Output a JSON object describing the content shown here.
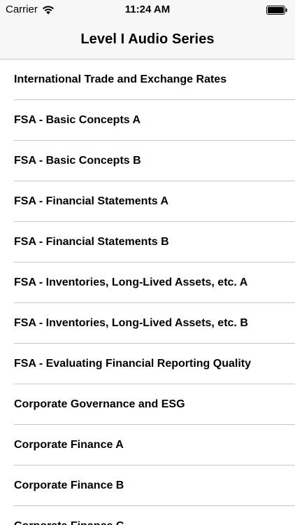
{
  "status_bar": {
    "carrier": "Carrier",
    "time": "11:24 AM",
    "wifi_icon": "wifi-icon",
    "battery_icon": "battery-icon"
  },
  "nav": {
    "title": "Level I Audio Series"
  },
  "items": [
    {
      "label": "International Trade and Exchange Rates"
    },
    {
      "label": "FSA - Basic Concepts A"
    },
    {
      "label": "FSA - Basic Concepts B"
    },
    {
      "label": "FSA - Financial Statements A"
    },
    {
      "label": "FSA - Financial Statements B"
    },
    {
      "label": "FSA - Inventories, Long-Lived Assets, etc. A"
    },
    {
      "label": "FSA - Inventories, Long-Lived Assets, etc. B"
    },
    {
      "label": "FSA - Evaluating Financial Reporting Quality"
    },
    {
      "label": "Corporate Governance and ESG"
    },
    {
      "label": "Corporate Finance A"
    },
    {
      "label": "Corporate Finance B"
    },
    {
      "label": "Corporate Finance C"
    }
  ]
}
